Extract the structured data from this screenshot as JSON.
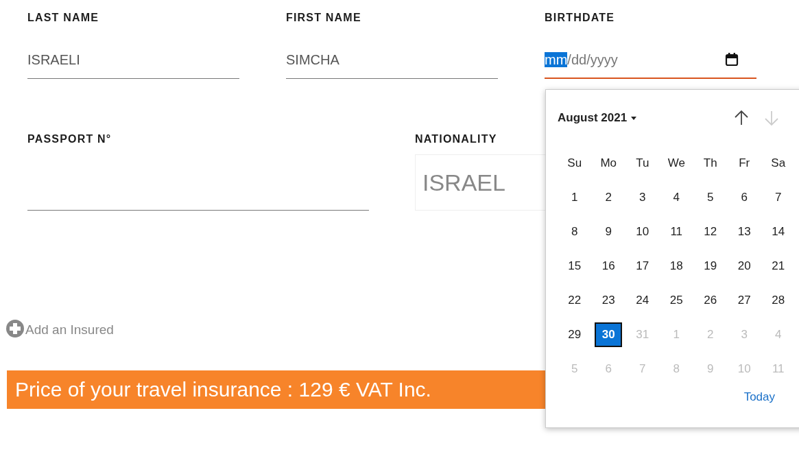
{
  "row_1": [
    {
      "label": "LAST NAME",
      "value": "ISRAELI"
    },
    {
      "label": "FIRST NAME",
      "value": "SIMCHA"
    }
  ],
  "birthdate": {
    "label": "BIRTHDATE",
    "focused": true,
    "segments": [
      {
        "text": "mm",
        "selected": true
      },
      {
        "text": "/",
        "selected": false
      },
      {
        "text": "dd",
        "selected": false
      },
      {
        "text": "/",
        "selected": false
      },
      {
        "text": "yyyy",
        "selected": false
      }
    ]
  },
  "passport": {
    "label": "PASSPORT N°"
  },
  "nationality": {
    "label": "NATIONALITY",
    "value": "ISRAEL"
  },
  "add_insured": {
    "label": "Add an Insured"
  },
  "price_banner": {
    "text": "Price of your travel insurance : 129 € VAT Inc."
  },
  "calendar": {
    "month": "August 2021",
    "previous_disabled": false,
    "next_disabled": true,
    "weekdays": [
      "Su",
      "Mo",
      "Tu",
      "We",
      "Th",
      "Fr",
      "Sa"
    ],
    "weeks": [
      [
        {
          "day": "1",
          "outside": false,
          "selected": false
        },
        {
          "day": "2",
          "outside": false,
          "selected": false
        },
        {
          "day": "3",
          "outside": false,
          "selected": false
        },
        {
          "day": "4",
          "outside": false,
          "selected": false
        },
        {
          "day": "5",
          "outside": false,
          "selected": false
        },
        {
          "day": "6",
          "outside": false,
          "selected": false
        },
        {
          "day": "7",
          "outside": false,
          "selected": false
        }
      ],
      [
        {
          "day": "8",
          "outside": false,
          "selected": false
        },
        {
          "day": "9",
          "outside": false,
          "selected": false
        },
        {
          "day": "10",
          "outside": false,
          "selected": false
        },
        {
          "day": "11",
          "outside": false,
          "selected": false
        },
        {
          "day": "12",
          "outside": false,
          "selected": false
        },
        {
          "day": "13",
          "outside": false,
          "selected": false
        },
        {
          "day": "14",
          "outside": false,
          "selected": false
        }
      ],
      [
        {
          "day": "15",
          "outside": false,
          "selected": false
        },
        {
          "day": "16",
          "outside": false,
          "selected": false
        },
        {
          "day": "17",
          "outside": false,
          "selected": false
        },
        {
          "day": "18",
          "outside": false,
          "selected": false
        },
        {
          "day": "19",
          "outside": false,
          "selected": false
        },
        {
          "day": "20",
          "outside": false,
          "selected": false
        },
        {
          "day": "21",
          "outside": false,
          "selected": false
        }
      ],
      [
        {
          "day": "22",
          "outside": false,
          "selected": false
        },
        {
          "day": "23",
          "outside": false,
          "selected": false
        },
        {
          "day": "24",
          "outside": false,
          "selected": false
        },
        {
          "day": "25",
          "outside": false,
          "selected": false
        },
        {
          "day": "26",
          "outside": false,
          "selected": false
        },
        {
          "day": "27",
          "outside": false,
          "selected": false
        },
        {
          "day": "28",
          "outside": false,
          "selected": false
        }
      ],
      [
        {
          "day": "29",
          "outside": false,
          "selected": false
        },
        {
          "day": "30",
          "outside": false,
          "selected": true
        },
        {
          "day": "31",
          "outside": true,
          "selected": false
        },
        {
          "day": "1",
          "outside": true,
          "selected": false
        },
        {
          "day": "2",
          "outside": true,
          "selected": false
        },
        {
          "day": "3",
          "outside": true,
          "selected": false
        },
        {
          "day": "4",
          "outside": true,
          "selected": false
        }
      ],
      [
        {
          "day": "5",
          "outside": true,
          "selected": false
        },
        {
          "day": "6",
          "outside": true,
          "selected": false
        },
        {
          "day": "7",
          "outside": true,
          "selected": false
        },
        {
          "day": "8",
          "outside": true,
          "selected": false
        },
        {
          "day": "9",
          "outside": true,
          "selected": false
        },
        {
          "day": "10",
          "outside": true,
          "selected": false
        },
        {
          "day": "11",
          "outside": true,
          "selected": false
        }
      ]
    ],
    "today_label": "Today"
  }
}
